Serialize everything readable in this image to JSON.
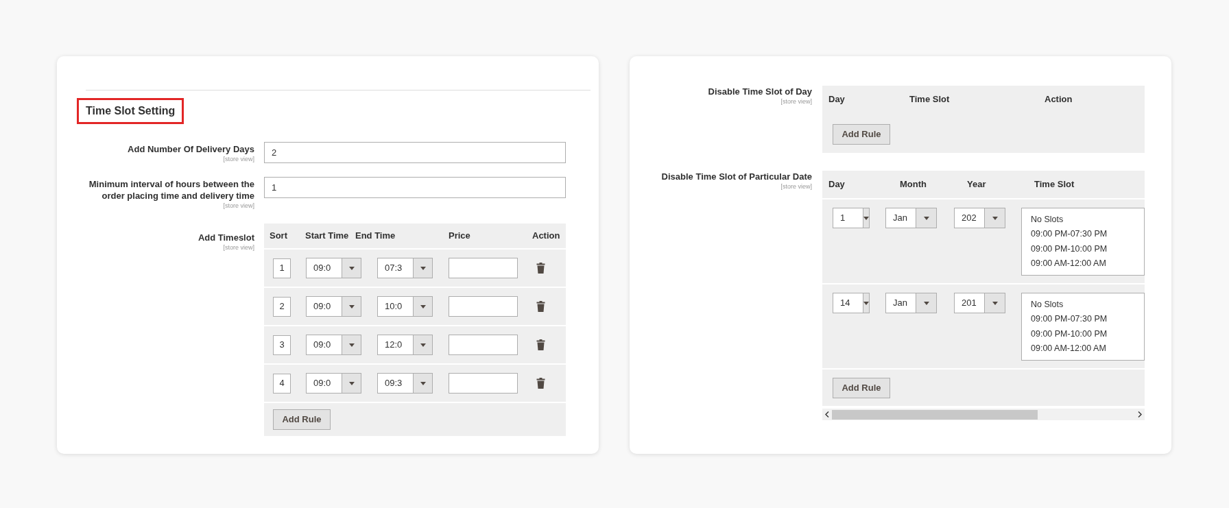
{
  "left": {
    "section_title": "Time Slot Setting",
    "fields": [
      {
        "label": "Add Number Of Delivery Days",
        "scope": "[store view]",
        "value": "2"
      },
      {
        "label": "Minimum interval of hours between the order placing time and delivery time",
        "scope": "[store view]",
        "value": "1"
      }
    ],
    "timeslot": {
      "label": "Add Timeslot",
      "scope": "[store view]",
      "columns": [
        "Sort",
        "Start Time",
        "End Time",
        "Price",
        "Action"
      ],
      "rows": [
        {
          "sort": "1",
          "start": "09:0",
          "end": "07:3"
        },
        {
          "sort": "2",
          "start": "09:0",
          "end": "10:0"
        },
        {
          "sort": "3",
          "start": "09:0",
          "end": "12:0"
        },
        {
          "sort": "4",
          "start": "09:0",
          "end": "09:3"
        }
      ],
      "button": "Add Rule"
    }
  },
  "right": {
    "day_rules": {
      "label": "Disable Time Slot of Day",
      "scope": "[store view]",
      "columns": [
        "Day",
        "Time Slot",
        "Action"
      ],
      "button": "Add Rule"
    },
    "date_rules": {
      "label": "Disable Time Slot of Particular Date",
      "scope": "[store view]",
      "columns": [
        "Day",
        "Month",
        "Year",
        "Time Slot"
      ],
      "rows": [
        {
          "day": "1",
          "month": "Jan",
          "year": "202",
          "time_slots": [
            "No Slots",
            "09:00 PM-07:30 PM",
            "09:00 PM-10:00 PM",
            "09:00 AM-12:00 AM"
          ]
        },
        {
          "day": "14",
          "month": "Jan",
          "year": "201",
          "time_slots": [
            "No Slots",
            "09:00 PM-07:30 PM",
            "09:00 PM-10:00 PM",
            "09:00 AM-12:00 AM"
          ]
        }
      ],
      "button": "Add Rule"
    }
  }
}
